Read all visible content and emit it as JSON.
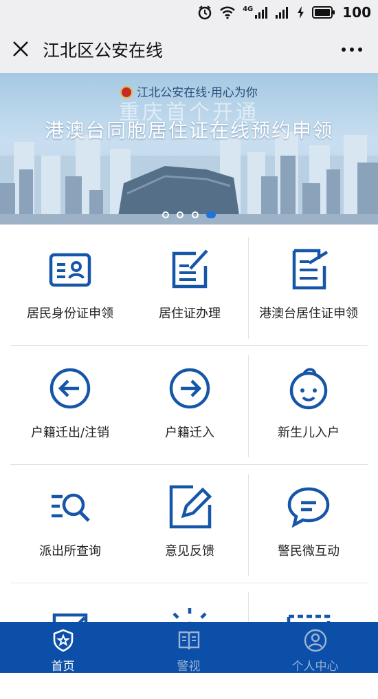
{
  "status_bar": {
    "network": "4G",
    "battery": "100"
  },
  "header": {
    "title": "江北区公安在线"
  },
  "banner": {
    "emblem_text": "江北公安在线·用心为你",
    "headline": "重庆首个开通",
    "subline": "港澳台同胞居住证在线预约申领",
    "slide_count": 4,
    "active_slide": 4
  },
  "services": [
    {
      "label": "居民身份证申领",
      "icon": "id-card-icon"
    },
    {
      "label": "居住证办理",
      "icon": "edit-form-icon"
    },
    {
      "label": "港澳台居住证申领",
      "icon": "document-edit-icon"
    },
    {
      "label": "户籍迁出/注销",
      "icon": "arrow-left-circle-icon"
    },
    {
      "label": "户籍迁入",
      "icon": "arrow-right-circle-icon"
    },
    {
      "label": "新生儿入户",
      "icon": "baby-face-icon"
    },
    {
      "label": "派出所查询",
      "icon": "list-search-icon"
    },
    {
      "label": "意见反馈",
      "icon": "pencil-square-icon"
    },
    {
      "label": "警民微互动",
      "icon": "chat-bubble-icon"
    }
  ],
  "partial_services": [
    {
      "icon": "form-pencil-icon"
    },
    {
      "icon": "light-bulb-icon"
    },
    {
      "icon": "dashed-frame-icon"
    }
  ],
  "tabs": [
    {
      "label": "首页",
      "icon": "police-badge-icon",
      "active": true
    },
    {
      "label": "警视",
      "icon": "book-icon",
      "active": false
    },
    {
      "label": "个人中心",
      "icon": "user-icon",
      "active": false
    }
  ],
  "colors": {
    "primary": "#0b4fa8",
    "icon_blue": "#1656a8",
    "tab_active": "#ffffff",
    "tab_inactive": "#9db3d4"
  }
}
